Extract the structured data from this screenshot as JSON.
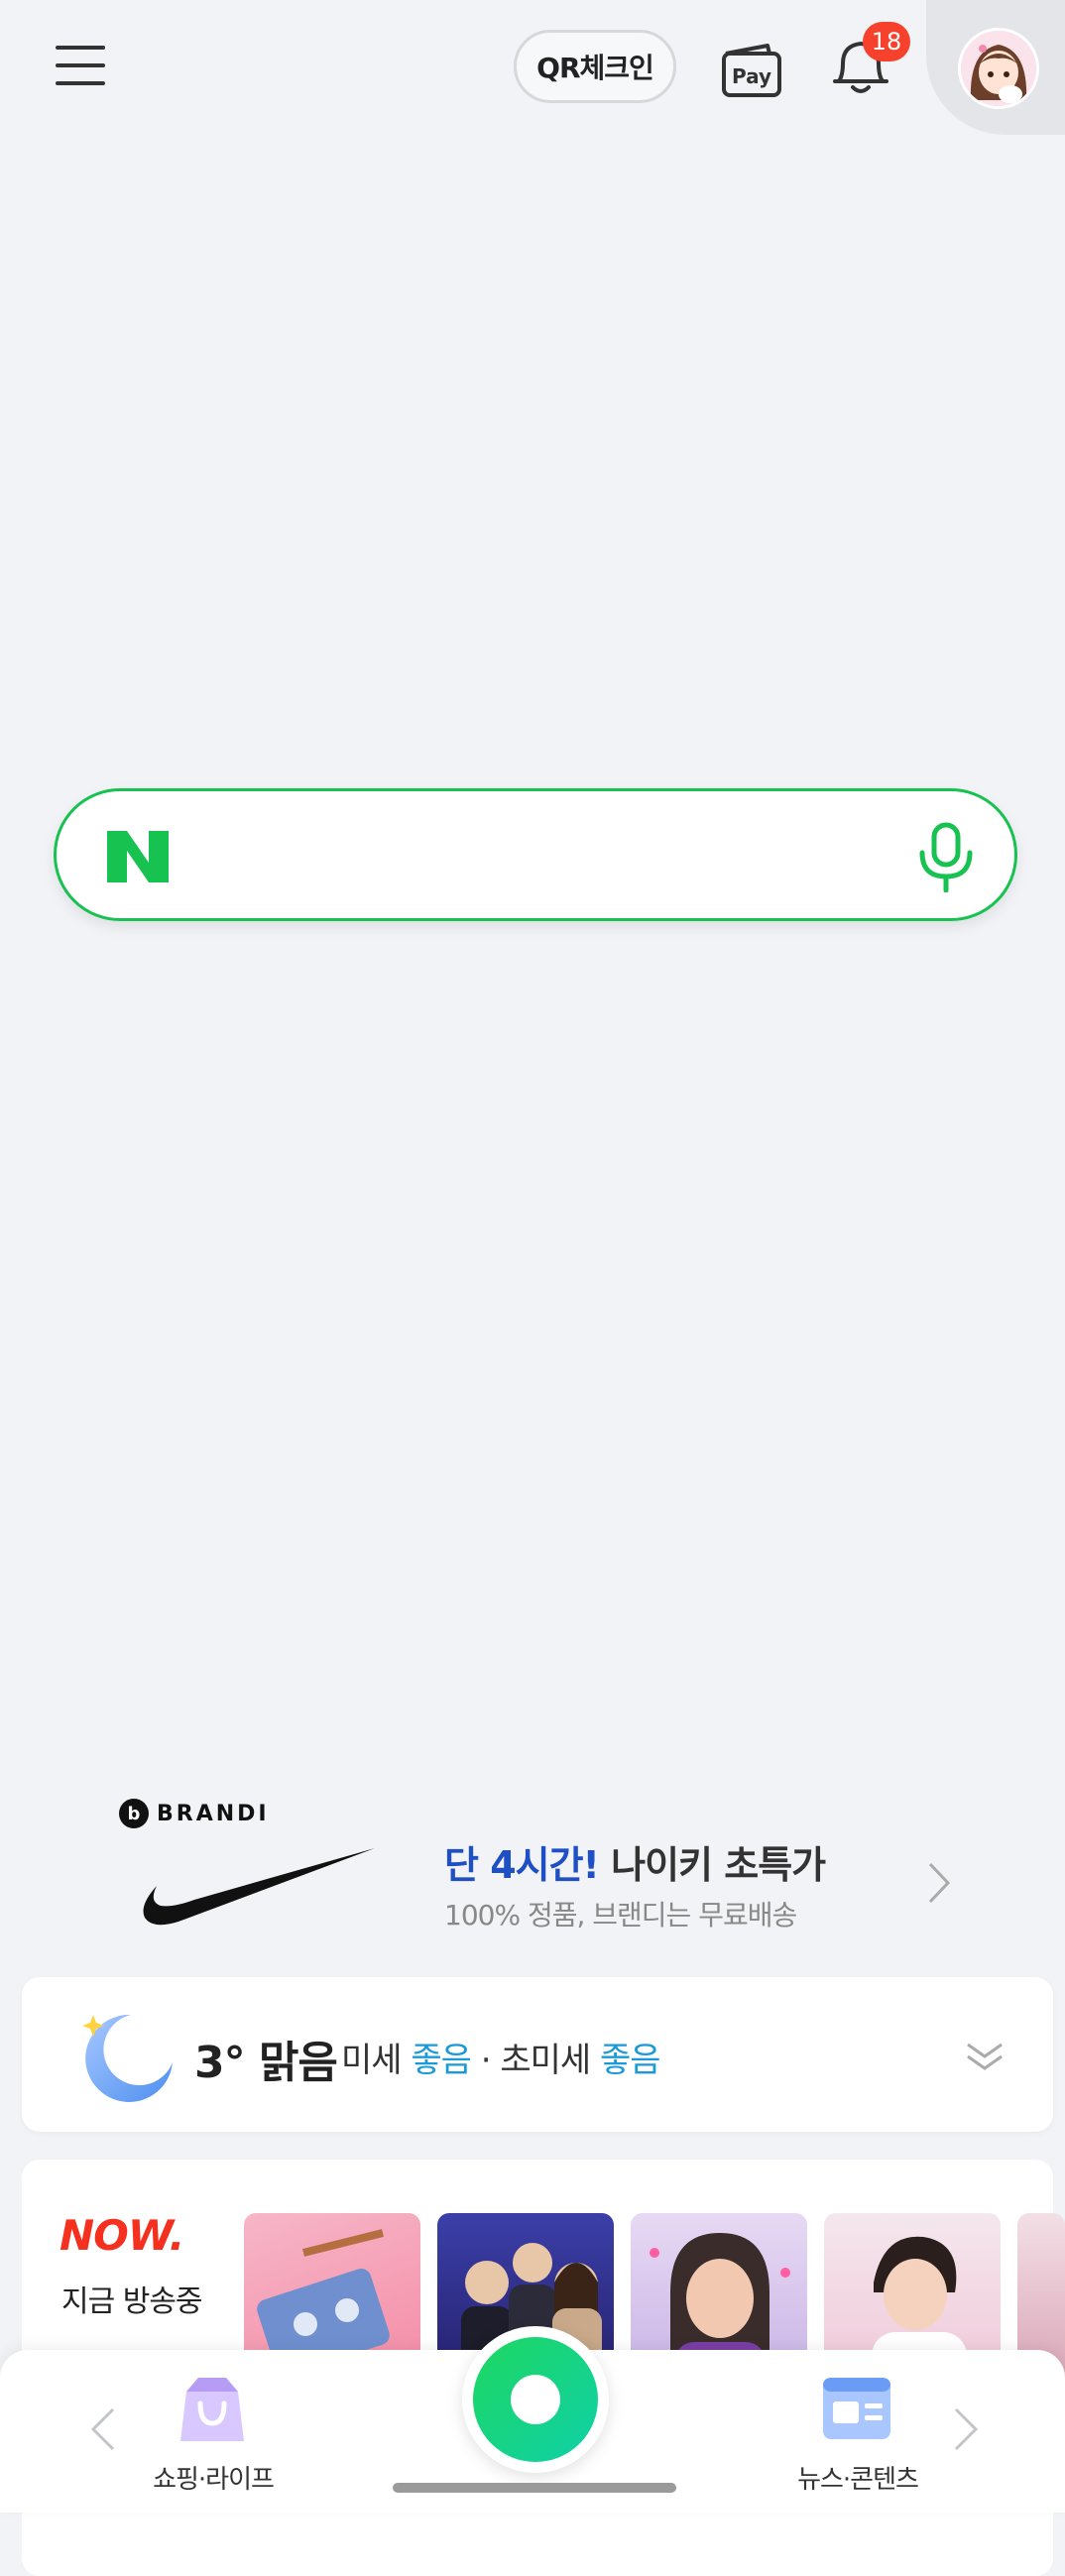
{
  "header": {
    "qr_label": "QR체크인",
    "pay_label": "Pay",
    "notification_count": "18"
  },
  "search": {
    "logo_letter": "N",
    "brand_color": "#18c251"
  },
  "ad": {
    "brand": "BRANDI",
    "headline_highlight": "단 4시간!",
    "headline_rest": " 나이키 초특가",
    "subtext": "100% 정품, 브랜디는 무료배송"
  },
  "weather": {
    "temperature": "3°",
    "condition": "맑음",
    "fine_dust_label": "미세",
    "fine_dust_value": "좋음",
    "separator": " · ",
    "ultrafine_dust_label": "초미세",
    "ultrafine_dust_value": "좋음"
  },
  "now": {
    "logo": "NOW.",
    "label": "지금 방송중"
  },
  "bottom_nav": {
    "left_label": "쇼핑·라이프",
    "right_label": "뉴스·콘텐츠"
  }
}
